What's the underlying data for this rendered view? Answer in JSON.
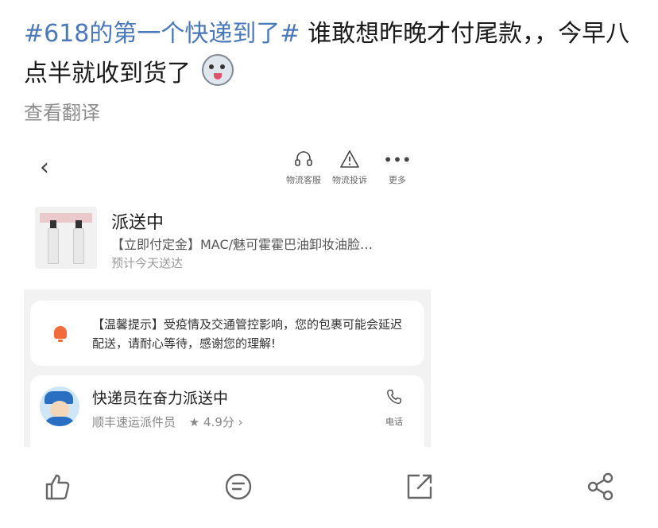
{
  "post": {
    "hashtag": "#618的第一个快递到了#",
    "text": "谁敢想昨晚才付尾款，，今早八点半就收到货了",
    "translate_link": "查看翻译"
  },
  "screenshot": {
    "toolbar": {
      "service_label": "物流客服",
      "complaint_label": "物流投诉",
      "more_label": "更多"
    },
    "order": {
      "status": "派送中",
      "product": "【立即付定金】MAC/魅可霍霍巴油卸妆油脸…",
      "eta": "预计今天送达"
    },
    "notice": {
      "text": "【温馨提示】受疫情及交通管控影响，您的包裹可能会延迟配送，请耐心等待，感谢您的理解!"
    },
    "courier": {
      "title": "快递员在奋力派送中",
      "company": "顺丰速运派件员",
      "rating": "★ 4.9分 ›",
      "phone_label": "电话"
    }
  },
  "icons": [
    "chevron-left-icon",
    "headset-icon",
    "warning-icon",
    "more-icon",
    "bell-icon",
    "phone-icon",
    "like-icon",
    "comment-icon",
    "repost-icon",
    "share-icon"
  ]
}
